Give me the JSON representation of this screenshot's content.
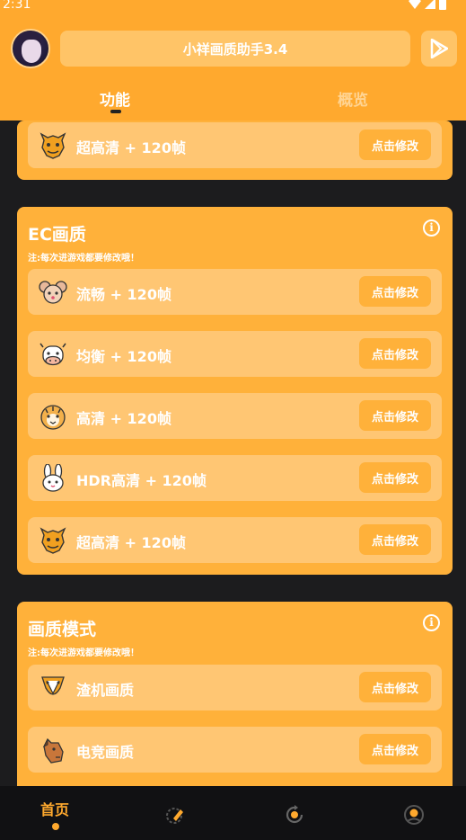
{
  "status_bar": {
    "time": "2:31"
  },
  "header": {
    "title": "小祥画质助手3.4",
    "tabs": [
      {
        "label": "功能",
        "active": true
      },
      {
        "label": "概览",
        "active": false
      }
    ]
  },
  "partial_card": {
    "row": {
      "icon": "dragon-icon",
      "label": "超高清 + 120帧",
      "button": "点击修改"
    }
  },
  "ec_card": {
    "title": "EC画质",
    "note": "注:每次进游戏都要修改哦！",
    "rows": [
      {
        "icon": "mouse-icon",
        "label": "流畅 + 120帧",
        "button": "点击修改"
      },
      {
        "icon": "cow-icon",
        "label": "均衡 + 120帧",
        "button": "点击修改"
      },
      {
        "icon": "tiger-icon",
        "label": "高清 + 120帧",
        "button": "点击修改"
      },
      {
        "icon": "rabbit-icon",
        "label": "HDR高清 + 120帧",
        "button": "点击修改"
      },
      {
        "icon": "dragon-icon",
        "label": "超高清 + 120帧",
        "button": "点击修改"
      }
    ]
  },
  "mode_card": {
    "title": "画质模式",
    "note": "注:每次进游戏都要修改哦！",
    "rows": [
      {
        "icon": "snake-icon",
        "label": "渣机画质",
        "button": "点击修改"
      },
      {
        "icon": "horse-icon",
        "label": "电竞画质",
        "button": "点击修改"
      }
    ]
  },
  "bottom_nav": {
    "items": [
      {
        "label": "首页",
        "active": true
      },
      {
        "icon": "edit-icon"
      },
      {
        "icon": "refresh-icon"
      },
      {
        "icon": "user-icon"
      }
    ]
  },
  "colors": {
    "accent": "#ffa92e",
    "card": "#ffb13a",
    "row": "#ffc673",
    "background": "#1c1c1e"
  }
}
